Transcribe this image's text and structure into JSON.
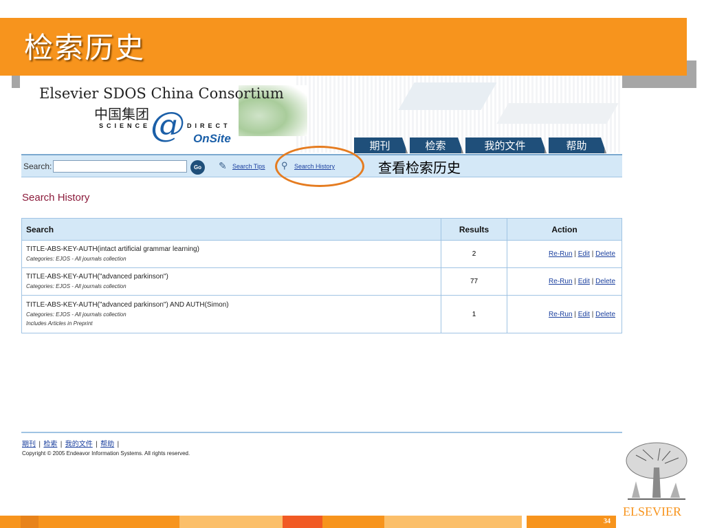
{
  "slide": {
    "title": "检索历史",
    "annotation": "查看检索历史",
    "page_number": "34",
    "brand_colors": {
      "orange": "#f7941d",
      "gray": "#a6a6a6"
    }
  },
  "logo": {
    "title": "Elsevier SDOS China Consortium",
    "cn": "中国集团",
    "science": "SCIENCE",
    "at": "@",
    "direct": "DIRECT",
    "onsite": "OnSite"
  },
  "tabs": [
    {
      "label": "期刊"
    },
    {
      "label": "检索"
    },
    {
      "label": "我的文件"
    },
    {
      "label": "帮助"
    }
  ],
  "search": {
    "label": "Search:",
    "value": "",
    "go_label": "Go",
    "tips_label": "Search Tips",
    "history_label": "Search History"
  },
  "history": {
    "title": "Search History",
    "columns": [
      "Search",
      "Results",
      "Action"
    ],
    "rows": [
      {
        "query": "TITLE-ABS-KEY-AUTH(intact artificial grammar learning)",
        "categories": "Categories: EJOS - All journals collection",
        "extra": "",
        "results": "2"
      },
      {
        "query": "TITLE-ABS-KEY-AUTH(\"advanced parkinson\")",
        "categories": "Categories: EJOS - All journals collection",
        "extra": "",
        "results": "77"
      },
      {
        "query": "TITLE-ABS-KEY-AUTH(\"advanced parkinson\") AND AUTH(Simon)",
        "categories": "Categories: EJOS - All journals collection",
        "extra": "Includes Articles in Preprint",
        "results": "1"
      }
    ],
    "actions": {
      "rerun": "Re-Run",
      "edit": "Edit",
      "delete": "Delete",
      "sep": "|"
    }
  },
  "footer": {
    "links": [
      "期刊",
      "检索",
      "我的文件",
      "帮助"
    ],
    "sep": "|",
    "copyright": "Copyright © 2005 Endeavor Information Systems. All rights reserved."
  },
  "publisher": {
    "name": "ELSEVIER"
  }
}
